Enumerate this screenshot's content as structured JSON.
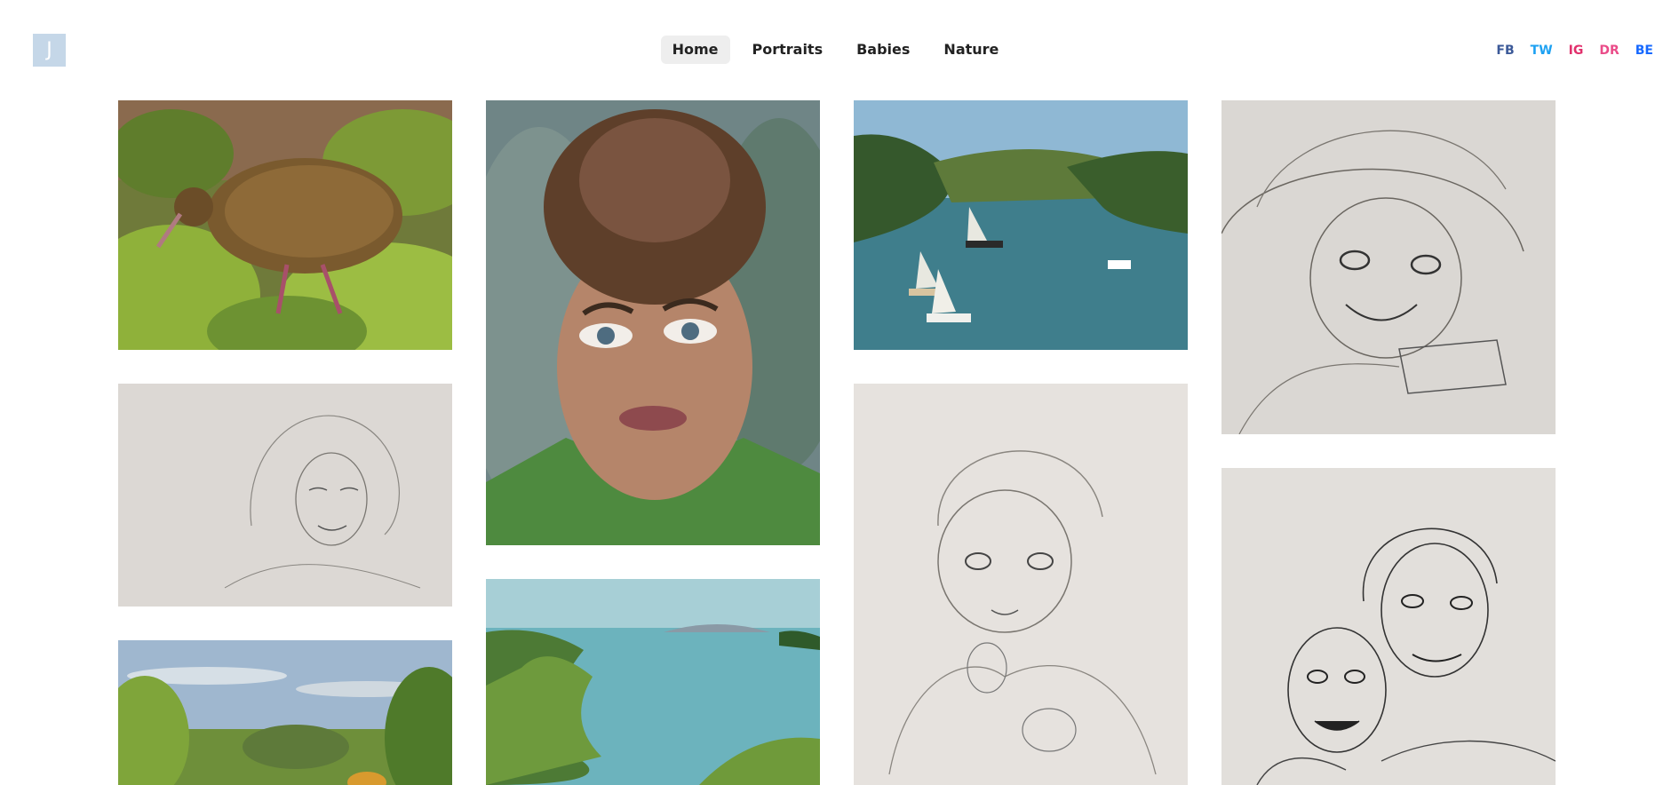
{
  "logo": {
    "letter": "J"
  },
  "nav": {
    "items": [
      {
        "label": "Home",
        "active": true
      },
      {
        "label": "Portraits",
        "active": false
      },
      {
        "label": "Babies",
        "active": false
      },
      {
        "label": "Nature",
        "active": false
      }
    ]
  },
  "social": {
    "links": [
      {
        "label": "FB",
        "color": "#3b5998"
      },
      {
        "label": "TW",
        "color": "#1da1f2"
      },
      {
        "label": "IG",
        "color": "#e1306c"
      },
      {
        "label": "DR",
        "color": "#ea4c89"
      },
      {
        "label": "BE",
        "color": "#1769ff"
      }
    ]
  },
  "gallery": {
    "artworks": [
      {
        "subject": "kiwi-bird-painting"
      },
      {
        "subject": "woman-pencil-sketch"
      },
      {
        "subject": "countryside-landscape-painting"
      },
      {
        "subject": "woman-portrait-painting"
      },
      {
        "subject": "coastal-bay-painting"
      },
      {
        "subject": "harbour-sailboats-painting"
      },
      {
        "subject": "baby-pencil-sketch"
      },
      {
        "subject": "child-with-hat-sketch"
      },
      {
        "subject": "two-women-ink-sketch"
      }
    ]
  }
}
